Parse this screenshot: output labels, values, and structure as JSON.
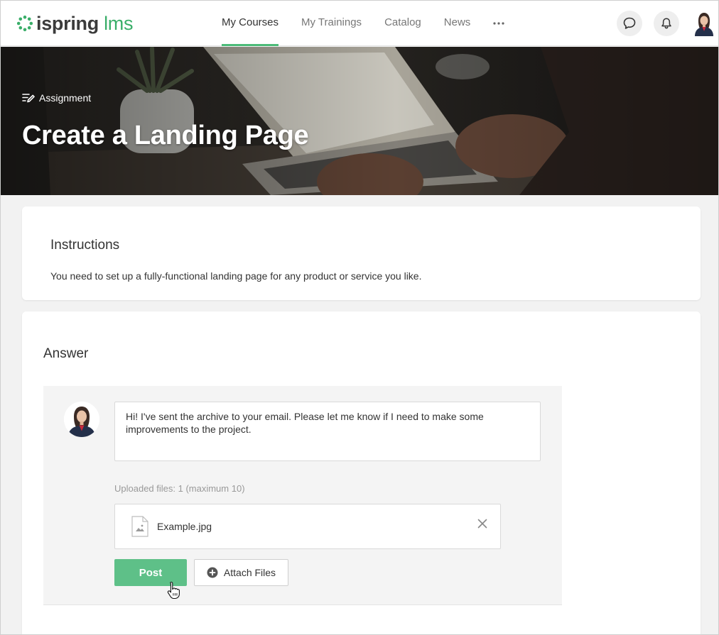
{
  "app": {
    "logo_main": "ispring",
    "logo_accent": "lms"
  },
  "nav": {
    "items": [
      {
        "label": "My Courses",
        "active": true
      },
      {
        "label": "My Trainings",
        "active": false
      },
      {
        "label": "Catalog",
        "active": false
      },
      {
        "label": "News",
        "active": false
      }
    ],
    "more_icon": "more-horizontal-icon"
  },
  "header_icons": [
    "chat-icon",
    "bell-icon",
    "user-avatar"
  ],
  "hero": {
    "type_label": "Assignment",
    "title": "Create a Landing Page"
  },
  "instructions": {
    "heading": "Instructions",
    "text": "You need to set up a fully-functional landing page for any product or service you like."
  },
  "answer": {
    "heading": "Answer",
    "message": "Hi! I've sent the archive to your email. Please let me know if I need to make some improvements to the project.",
    "uploaded_info": "Uploaded files: 1 (maximum 10)",
    "files": [
      {
        "name": "Example.jpg"
      }
    ],
    "post_label": "Post",
    "attach_label": "Attach Files"
  },
  "colors": {
    "accent": "#4cbb78",
    "post_button": "#5ec088",
    "page_bg": "#f2f2f2"
  }
}
